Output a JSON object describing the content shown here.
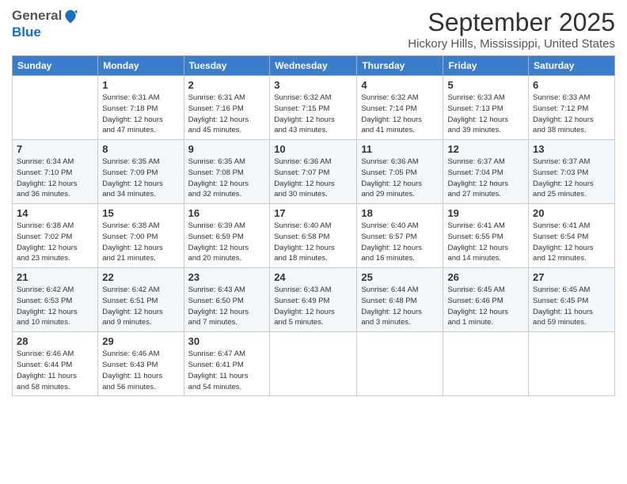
{
  "header": {
    "logo_general": "General",
    "logo_blue": "Blue",
    "month_title": "September 2025",
    "subtitle": "Hickory Hills, Mississippi, United States"
  },
  "days_of_week": [
    "Sunday",
    "Monday",
    "Tuesday",
    "Wednesday",
    "Thursday",
    "Friday",
    "Saturday"
  ],
  "weeks": [
    [
      {
        "num": "",
        "info": ""
      },
      {
        "num": "1",
        "info": "Sunrise: 6:31 AM\nSunset: 7:18 PM\nDaylight: 12 hours\nand 47 minutes."
      },
      {
        "num": "2",
        "info": "Sunrise: 6:31 AM\nSunset: 7:16 PM\nDaylight: 12 hours\nand 45 minutes."
      },
      {
        "num": "3",
        "info": "Sunrise: 6:32 AM\nSunset: 7:15 PM\nDaylight: 12 hours\nand 43 minutes."
      },
      {
        "num": "4",
        "info": "Sunrise: 6:32 AM\nSunset: 7:14 PM\nDaylight: 12 hours\nand 41 minutes."
      },
      {
        "num": "5",
        "info": "Sunrise: 6:33 AM\nSunset: 7:13 PM\nDaylight: 12 hours\nand 39 minutes."
      },
      {
        "num": "6",
        "info": "Sunrise: 6:33 AM\nSunset: 7:12 PM\nDaylight: 12 hours\nand 38 minutes."
      }
    ],
    [
      {
        "num": "7",
        "info": "Sunrise: 6:34 AM\nSunset: 7:10 PM\nDaylight: 12 hours\nand 36 minutes."
      },
      {
        "num": "8",
        "info": "Sunrise: 6:35 AM\nSunset: 7:09 PM\nDaylight: 12 hours\nand 34 minutes."
      },
      {
        "num": "9",
        "info": "Sunrise: 6:35 AM\nSunset: 7:08 PM\nDaylight: 12 hours\nand 32 minutes."
      },
      {
        "num": "10",
        "info": "Sunrise: 6:36 AM\nSunset: 7:07 PM\nDaylight: 12 hours\nand 30 minutes."
      },
      {
        "num": "11",
        "info": "Sunrise: 6:36 AM\nSunset: 7:05 PM\nDaylight: 12 hours\nand 29 minutes."
      },
      {
        "num": "12",
        "info": "Sunrise: 6:37 AM\nSunset: 7:04 PM\nDaylight: 12 hours\nand 27 minutes."
      },
      {
        "num": "13",
        "info": "Sunrise: 6:37 AM\nSunset: 7:03 PM\nDaylight: 12 hours\nand 25 minutes."
      }
    ],
    [
      {
        "num": "14",
        "info": "Sunrise: 6:38 AM\nSunset: 7:02 PM\nDaylight: 12 hours\nand 23 minutes."
      },
      {
        "num": "15",
        "info": "Sunrise: 6:38 AM\nSunset: 7:00 PM\nDaylight: 12 hours\nand 21 minutes."
      },
      {
        "num": "16",
        "info": "Sunrise: 6:39 AM\nSunset: 6:59 PM\nDaylight: 12 hours\nand 20 minutes."
      },
      {
        "num": "17",
        "info": "Sunrise: 6:40 AM\nSunset: 6:58 PM\nDaylight: 12 hours\nand 18 minutes."
      },
      {
        "num": "18",
        "info": "Sunrise: 6:40 AM\nSunset: 6:57 PM\nDaylight: 12 hours\nand 16 minutes."
      },
      {
        "num": "19",
        "info": "Sunrise: 6:41 AM\nSunset: 6:55 PM\nDaylight: 12 hours\nand 14 minutes."
      },
      {
        "num": "20",
        "info": "Sunrise: 6:41 AM\nSunset: 6:54 PM\nDaylight: 12 hours\nand 12 minutes."
      }
    ],
    [
      {
        "num": "21",
        "info": "Sunrise: 6:42 AM\nSunset: 6:53 PM\nDaylight: 12 hours\nand 10 minutes."
      },
      {
        "num": "22",
        "info": "Sunrise: 6:42 AM\nSunset: 6:51 PM\nDaylight: 12 hours\nand 9 minutes."
      },
      {
        "num": "23",
        "info": "Sunrise: 6:43 AM\nSunset: 6:50 PM\nDaylight: 12 hours\nand 7 minutes."
      },
      {
        "num": "24",
        "info": "Sunrise: 6:43 AM\nSunset: 6:49 PM\nDaylight: 12 hours\nand 5 minutes."
      },
      {
        "num": "25",
        "info": "Sunrise: 6:44 AM\nSunset: 6:48 PM\nDaylight: 12 hours\nand 3 minutes."
      },
      {
        "num": "26",
        "info": "Sunrise: 6:45 AM\nSunset: 6:46 PM\nDaylight: 12 hours\nand 1 minute."
      },
      {
        "num": "27",
        "info": "Sunrise: 6:45 AM\nSunset: 6:45 PM\nDaylight: 11 hours\nand 59 minutes."
      }
    ],
    [
      {
        "num": "28",
        "info": "Sunrise: 6:46 AM\nSunset: 6:44 PM\nDaylight: 11 hours\nand 58 minutes."
      },
      {
        "num": "29",
        "info": "Sunrise: 6:46 AM\nSunset: 6:43 PM\nDaylight: 11 hours\nand 56 minutes."
      },
      {
        "num": "30",
        "info": "Sunrise: 6:47 AM\nSunset: 6:41 PM\nDaylight: 11 hours\nand 54 minutes."
      },
      {
        "num": "",
        "info": ""
      },
      {
        "num": "",
        "info": ""
      },
      {
        "num": "",
        "info": ""
      },
      {
        "num": "",
        "info": ""
      }
    ]
  ]
}
